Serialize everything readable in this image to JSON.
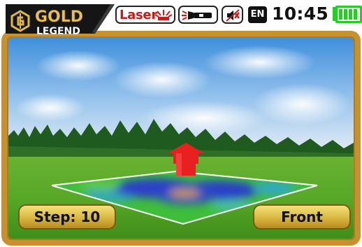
{
  "brand": {
    "name_top": "GOLD",
    "name_bottom": "LEGEND"
  },
  "status_bar": {
    "laser_label": "Laser",
    "language": "EN",
    "time": "10:45",
    "battery_level": 1.0
  },
  "buttons": {
    "step_label": "Step: 10",
    "view_label": "Front"
  },
  "colors": {
    "frame_gold": "#c8912f",
    "laser_red": "#d01818",
    "battery_green": "#22d022",
    "arrow_red": "#e82020"
  }
}
